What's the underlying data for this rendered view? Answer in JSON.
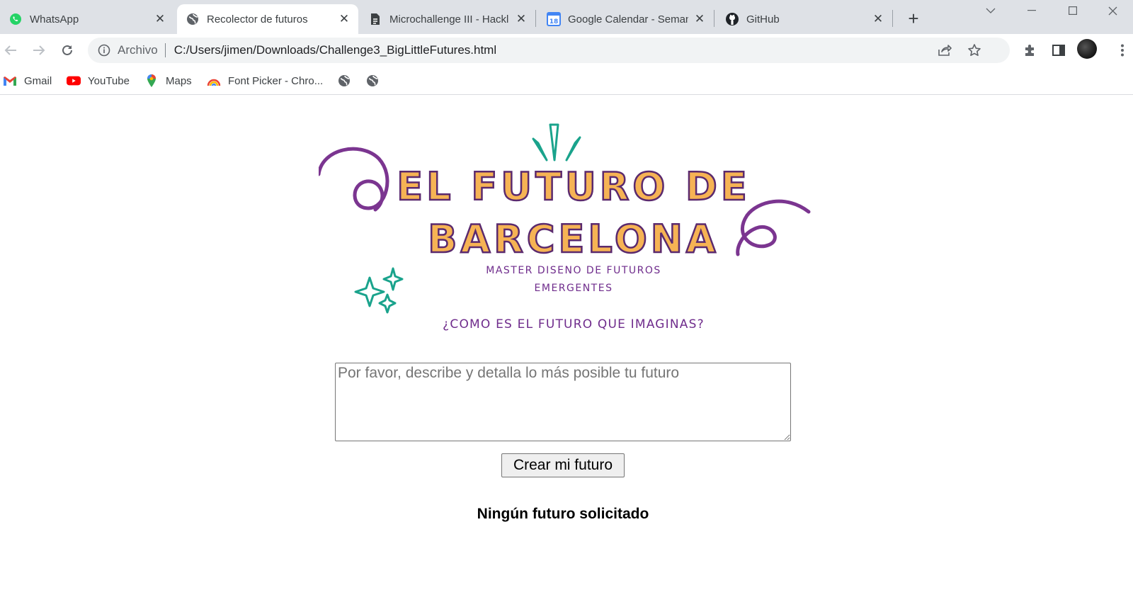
{
  "browser": {
    "tabs": [
      {
        "title": "WhatsApp",
        "icon": "whatsapp-icon",
        "active": false
      },
      {
        "title": "Recolector de futuros",
        "icon": "globe-icon",
        "active": true
      },
      {
        "title": "Microchallenge III - Hackl",
        "icon": "document-icon",
        "active": false
      },
      {
        "title": "Google Calendar - Seman",
        "icon": "calendar-icon",
        "active": false,
        "badge": "18"
      },
      {
        "title": "GitHub",
        "icon": "github-icon",
        "active": false
      }
    ],
    "new_tab_label": "+",
    "close_glyph": "✕",
    "address": {
      "scheme_label": "Archivo",
      "url": "C:/Users/jimen/Downloads/Challenge3_BigLittleFutures.html"
    },
    "bookmarks": [
      {
        "label": "Gmail",
        "icon": "gmail-icon"
      },
      {
        "label": "YouTube",
        "icon": "youtube-icon"
      },
      {
        "label": "Maps",
        "icon": "maps-icon"
      },
      {
        "label": "Font Picker - Chro...",
        "icon": "font-picker-icon"
      },
      {
        "label": "",
        "icon": "globe-icon"
      },
      {
        "label": "",
        "icon": "globe-icon"
      }
    ],
    "colors": {
      "tabstrip": "#dee1e6",
      "omnibox": "#f1f3f4"
    }
  },
  "page": {
    "hero": {
      "title_line1": "EL FUTURO DE",
      "title_line2": "BARCELONA",
      "subtitle_line1": "MASTER DISENO DE FUTUROS",
      "subtitle_line2": "EMERGENTES",
      "question": "¿COMO ES EL FUTURO QUE IMAGINAS?",
      "colors": {
        "title_fill": "#f6b354",
        "title_outline": "#5b2a6e",
        "purple": "#6f2c8c",
        "teal": "#1aa38c"
      }
    },
    "input": {
      "placeholder": "Por favor, describe y detalla lo más posible tu futuro",
      "value": ""
    },
    "submit_label": "Crear mi futuro",
    "status_text": "Ningún futuro solicitado"
  }
}
